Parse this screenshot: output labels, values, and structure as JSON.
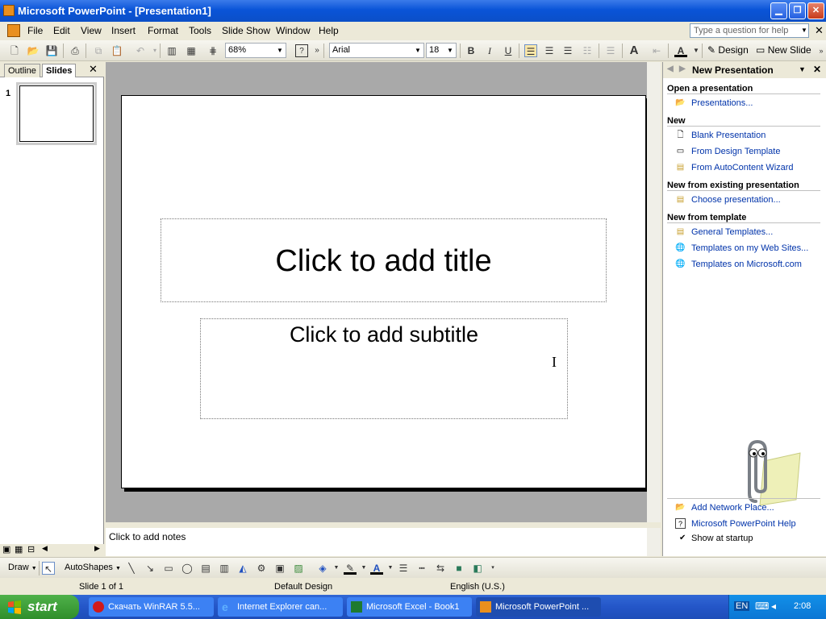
{
  "window": {
    "title": "Microsoft PowerPoint - [Presentation1]"
  },
  "menu": {
    "items": [
      "File",
      "Edit",
      "View",
      "Insert",
      "Format",
      "Tools",
      "Slide Show",
      "Window",
      "Help"
    ],
    "help_placeholder": "Type a question for help"
  },
  "toolbar": {
    "zoom": "68%",
    "font_name": "Arial",
    "font_size": "18",
    "design_label": "Design",
    "new_slide_label": "New Slide"
  },
  "left_pane": {
    "tabs": [
      "Outline",
      "Slides"
    ],
    "active_tab": "Slides",
    "slide_number": "1"
  },
  "slide": {
    "title_placeholder": "Click to add title",
    "subtitle_placeholder": "Click to add subtitle"
  },
  "notes": {
    "placeholder": "Click to add notes"
  },
  "task_pane": {
    "title": "New Presentation",
    "sections": [
      {
        "heading": "Open a presentation",
        "links": [
          "Presentations..."
        ]
      },
      {
        "heading": "New",
        "links": [
          "Blank Presentation",
          "From Design Template",
          "From AutoContent Wizard"
        ]
      },
      {
        "heading": "New from existing presentation",
        "links": [
          "Choose presentation..."
        ]
      },
      {
        "heading": "New from template",
        "links": [
          "General Templates...",
          "Templates on my Web Sites...",
          "Templates on Microsoft.com"
        ]
      }
    ],
    "footer_links": [
      "Add Network Place...",
      "Microsoft PowerPoint Help"
    ],
    "show_at_startup": "Show at startup",
    "show_at_startup_checked": true
  },
  "drawing_toolbar": {
    "draw_label": "Draw",
    "autoshapes_label": "AutoShapes"
  },
  "status_bar": {
    "slide_info": "Slide 1 of 1",
    "design": "Default Design",
    "language": "English (U.S.)"
  },
  "taskbar": {
    "start_label": "start",
    "tasks": [
      "Скачать WinRAR 5.5...",
      "Internet Explorer can...",
      "Microsoft Excel - Book1",
      "Microsoft PowerPoint ..."
    ],
    "active_task_index": 3,
    "language": "EN",
    "clock": "2:08"
  },
  "colors": {
    "titlebar": "#0a54d8",
    "taskbar": "#2456c8",
    "start_button": "#3c9a36",
    "link": "#0033aa"
  }
}
